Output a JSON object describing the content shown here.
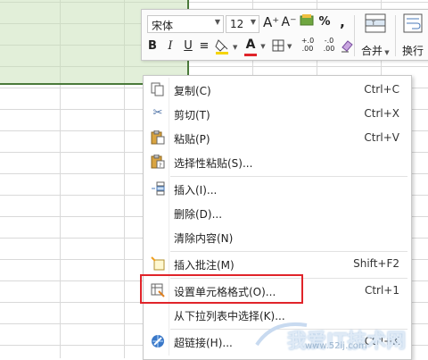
{
  "toolbar": {
    "font_name": "宋体",
    "font_size": "12",
    "grow_font": "A⁺",
    "shrink_font": "A⁻",
    "percent": "%",
    "comma": ",",
    "bold": "B",
    "italic": "I",
    "underline": "U",
    "strike": "≡",
    "font_color": "A",
    "inc_decimal": "+.0\n.00",
    "dec_decimal": "-.0\n.00",
    "merge_label": "合并",
    "wrap_label": "换行"
  },
  "menu": {
    "items": [
      {
        "label": "复制(C)",
        "shortcut": "Ctrl+C",
        "icon": "copy-icon"
      },
      {
        "label": "剪切(T)",
        "shortcut": "Ctrl+X",
        "icon": "cut-icon"
      },
      {
        "label": "粘贴(P)",
        "shortcut": "Ctrl+V",
        "icon": "paste-icon"
      },
      {
        "label": "选择性粘贴(S)...",
        "shortcut": "",
        "icon": "paste-special-icon"
      },
      {
        "label": "插入(I)...",
        "shortcut": "",
        "icon": "insert-icon"
      },
      {
        "label": "删除(D)...",
        "shortcut": "",
        "icon": ""
      },
      {
        "label": "清除内容(N)",
        "shortcut": "",
        "icon": ""
      },
      {
        "label": "插入批注(M)",
        "shortcut": "Shift+F2",
        "icon": "comment-icon"
      },
      {
        "label": "设置单元格格式(O)...",
        "shortcut": "Ctrl+1",
        "icon": "format-cells-icon"
      },
      {
        "label": "从下拉列表中选择(K)...",
        "shortcut": "",
        "icon": ""
      },
      {
        "label": "超链接(H)...",
        "shortcut": "Ctrl+K",
        "icon": "hyperlink-icon"
      }
    ]
  },
  "watermark": {
    "text": "我爱IT技术网",
    "url": "www.52ij.com"
  },
  "colors": {
    "selection_fill": "#e2efd9",
    "highlight_border": "#e0242a",
    "font_color_bar": "#e0242a",
    "fill_color_bar": "#f5d400"
  }
}
